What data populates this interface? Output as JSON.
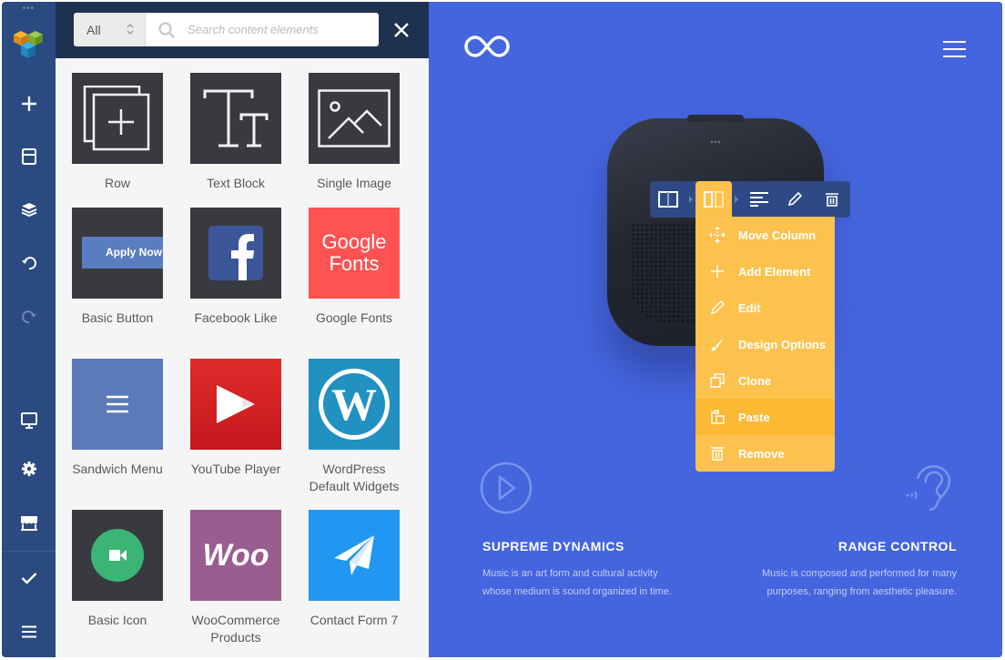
{
  "toolbar": {
    "logo": "visual-composer-logo",
    "buttons": [
      {
        "name": "add-element",
        "icon": "plus-icon"
      },
      {
        "name": "templates",
        "icon": "template-icon"
      },
      {
        "name": "tree-view",
        "icon": "layers-icon"
      },
      {
        "name": "undo",
        "icon": "undo-icon"
      },
      {
        "name": "redo",
        "icon": "redo-icon",
        "disabled": true
      },
      {
        "name": "responsive-view",
        "icon": "monitor-icon"
      },
      {
        "name": "settings",
        "icon": "gear-icon"
      },
      {
        "name": "hub",
        "icon": "store-icon"
      },
      {
        "name": "publish",
        "icon": "check-icon"
      },
      {
        "name": "menu",
        "icon": "hamburger-icon"
      }
    ]
  },
  "panel": {
    "category_select": {
      "value": "All"
    },
    "search": {
      "placeholder": "Search content elements",
      "value": ""
    },
    "close_icon": "close-icon",
    "elements": [
      {
        "label": "Row",
        "icon": "row-icon",
        "bg": "#393a40"
      },
      {
        "label": "Text Block",
        "icon": "text-block-icon",
        "bg": "#393a40"
      },
      {
        "label": "Single Image",
        "icon": "image-icon",
        "bg": "#393a40"
      },
      {
        "label": "Basic Button",
        "icon": "button-preview",
        "bg": "#393a40",
        "preview_text": "Apply Now"
      },
      {
        "label": "Facebook Like",
        "icon": "facebook-icon",
        "bg": "#393a40"
      },
      {
        "label": "Google Fonts",
        "icon": "google-fonts-icon",
        "bg": "#ff5252",
        "preview_text_1": "Google",
        "preview_text_2": "Fonts"
      },
      {
        "label": "Sandwich Menu",
        "icon": "hamburger-icon",
        "bg": "#5a7ab8"
      },
      {
        "label": "YouTube Player",
        "icon": "youtube-play-icon",
        "bg": "#d9232a"
      },
      {
        "label": "WordPress Default Widgets",
        "label_lines": [
          "WordPress",
          "Default Widgets"
        ],
        "icon": "wordpress-icon",
        "bg": "#2191c1"
      },
      {
        "label": "Basic Icon",
        "icon": "video-camera-icon",
        "bg": "#393a40"
      },
      {
        "label": "WooCommerce Products",
        "label_lines": [
          "WooCommerce",
          "Products"
        ],
        "icon": "woo-icon",
        "bg": "#9b5c8f",
        "preview_text": "Woo"
      },
      {
        "label": "Contact Form 7",
        "icon": "paper-plane-icon",
        "bg": "#2196f3"
      }
    ]
  },
  "canvas": {
    "bg_color": "#4565de",
    "brand_icon": "infinity-icon",
    "menu_icon": "hamburger-icon",
    "column_toolbar": {
      "buttons": [
        {
          "name": "row-controls",
          "icon": "row-layout-icon"
        },
        {
          "name": "column-controls",
          "icon": "column-layout-icon",
          "active": true
        },
        {
          "name": "element-controls",
          "icon": "text-align-icon"
        },
        {
          "name": "edit",
          "icon": "pencil-icon"
        },
        {
          "name": "remove",
          "icon": "trash-icon"
        }
      ]
    },
    "context_menu": {
      "accent": "#fcc24d",
      "items": [
        {
          "label": "Move Column",
          "icon": "move-icon"
        },
        {
          "label": "Add Element",
          "icon": "plus-icon"
        },
        {
          "label": "Edit",
          "icon": "pencil-icon"
        },
        {
          "label": "Design Options",
          "icon": "brush-icon"
        },
        {
          "label": "Clone",
          "icon": "clone-icon"
        },
        {
          "label": "Paste",
          "icon": "paste-icon",
          "hovered": true
        },
        {
          "label": "Remove",
          "icon": "trash-icon"
        }
      ]
    },
    "features": [
      {
        "icon": "play-circle-icon",
        "title": "SUPREME DYNAMICS",
        "lines": [
          "Music is an art form and cultural activity",
          "whose medium is sound organized in time."
        ]
      },
      {
        "icon": "ear-icon",
        "title": "RANGE CONTROL",
        "lines": [
          "Music is composed and performed for many",
          "purposes, ranging from aesthetic pleasure."
        ]
      }
    ]
  }
}
